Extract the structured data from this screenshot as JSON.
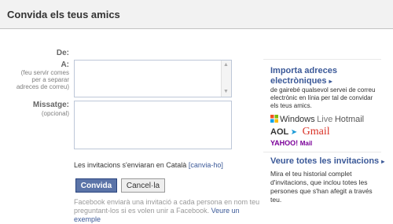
{
  "header": {
    "title": "Convida els teus amics"
  },
  "form": {
    "from_label": "De:",
    "to_label": "A:",
    "to_hint_1": "(feu servir comes",
    "to_hint_2": "per a separar",
    "to_hint_3": "adreces de correu)",
    "message_label": "Missatge:",
    "message_hint": "(opcional)",
    "language_text": "Les invitacions s'enviaran en Català",
    "language_link": "[canvia-ho]",
    "submit_label": "Convida",
    "cancel_label": "Cancel·la",
    "footnote_1": "Facebook enviarà una invitació a cada persona en nom teu",
    "footnote_2": "preguntant-los si es volen unir a Facebook.",
    "footnote_link": "Veure un exemple"
  },
  "sidebar": {
    "import_heading_1": "Importa adreces",
    "import_heading_2": "electròniques",
    "import_desc_1": "de gairebé qualsevol servei de correu",
    "import_desc_2": "electrònic en línia per tal de convidar",
    "import_desc_3": "els teus amics.",
    "providers": {
      "windows": "Windows",
      "live": "Live",
      "hotmail": "Hotmail",
      "aol": "AOL",
      "gmail": "Gmail",
      "yahoo": "YAHOO!",
      "yahoo_mail": "Mail"
    },
    "history_heading": "Veure totes les invitacions",
    "history_desc_1": "Mira el teu historial complet",
    "history_desc_2": "d'invitacions, que inclou totes les",
    "history_desc_3": "persones que s'han afegit a través",
    "history_desc_4": "teu."
  },
  "colors": {
    "brand": "#3b5998",
    "button": "#5b74a8"
  }
}
